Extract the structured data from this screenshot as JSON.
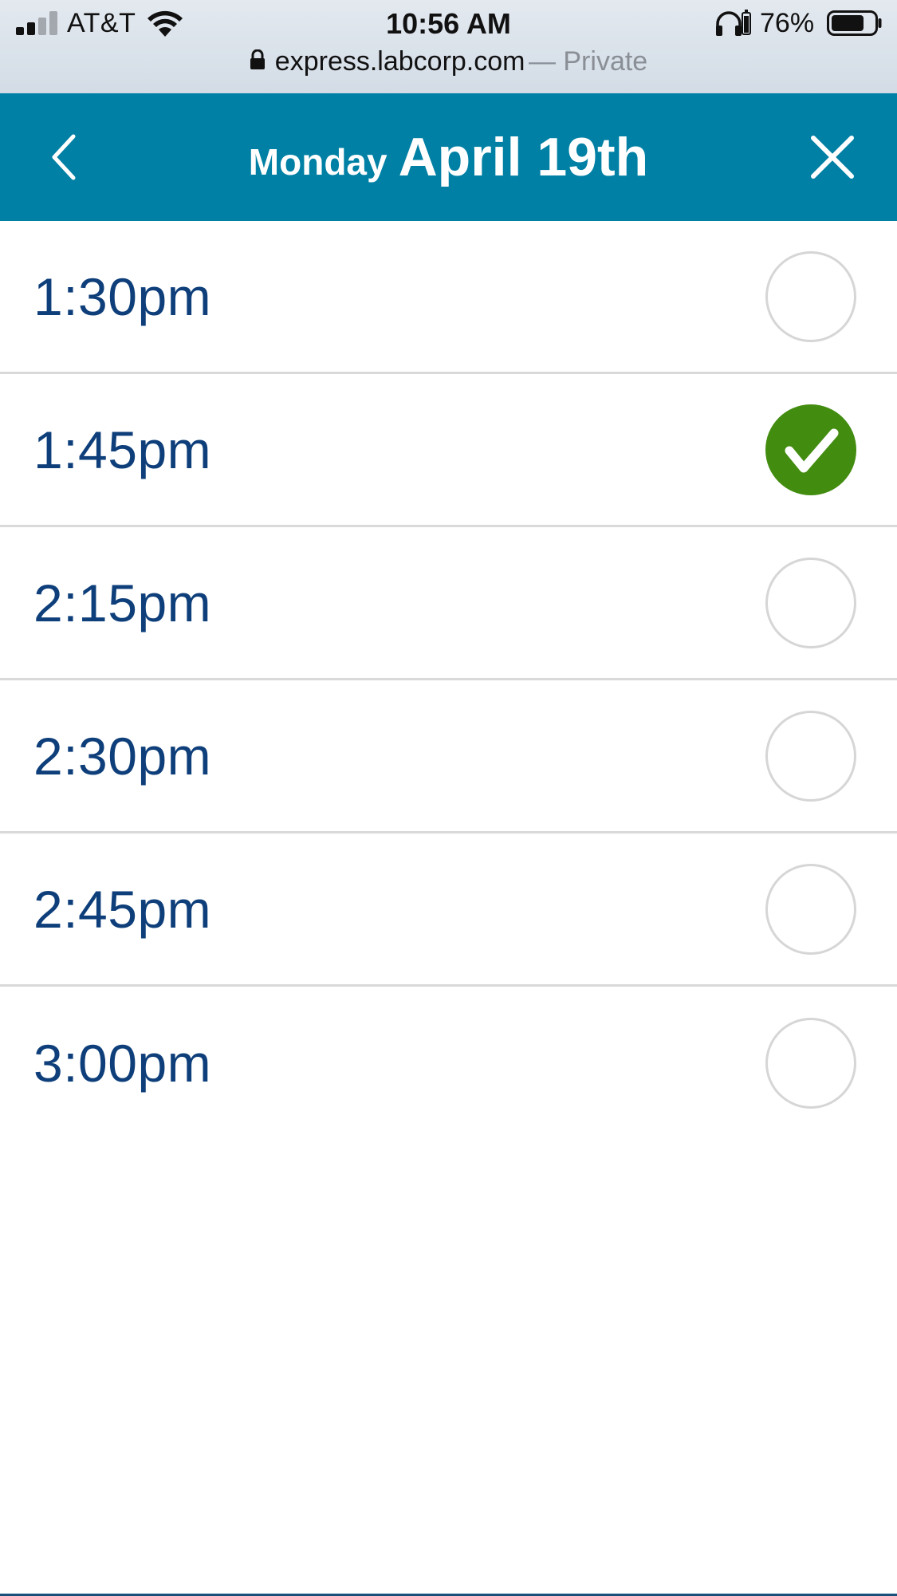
{
  "status_bar": {
    "carrier": "AT&T",
    "time": "10:56 AM",
    "battery_percent": "76%",
    "battery_level": 0.76,
    "signal_bars": 2
  },
  "url_bar": {
    "host": "express.labcorp.com",
    "mode": "— Private"
  },
  "header": {
    "weekday": "Monday",
    "date": "April 19th",
    "background": "#0080a4"
  },
  "slots": [
    {
      "time": "1:30pm",
      "selected": false
    },
    {
      "time": "1:45pm",
      "selected": true
    },
    {
      "time": "2:15pm",
      "selected": false
    },
    {
      "time": "2:30pm",
      "selected": false
    },
    {
      "time": "2:45pm",
      "selected": false
    },
    {
      "time": "3:00pm",
      "selected": false
    }
  ],
  "colors": {
    "time_text": "#0e3f7a",
    "selected_check": "#428c0f",
    "radio_border": "#d6d6d6"
  },
  "icons": {
    "back": "chevron-left-icon",
    "close": "close-icon",
    "check": "checkmark-icon",
    "lock": "lock-icon"
  }
}
